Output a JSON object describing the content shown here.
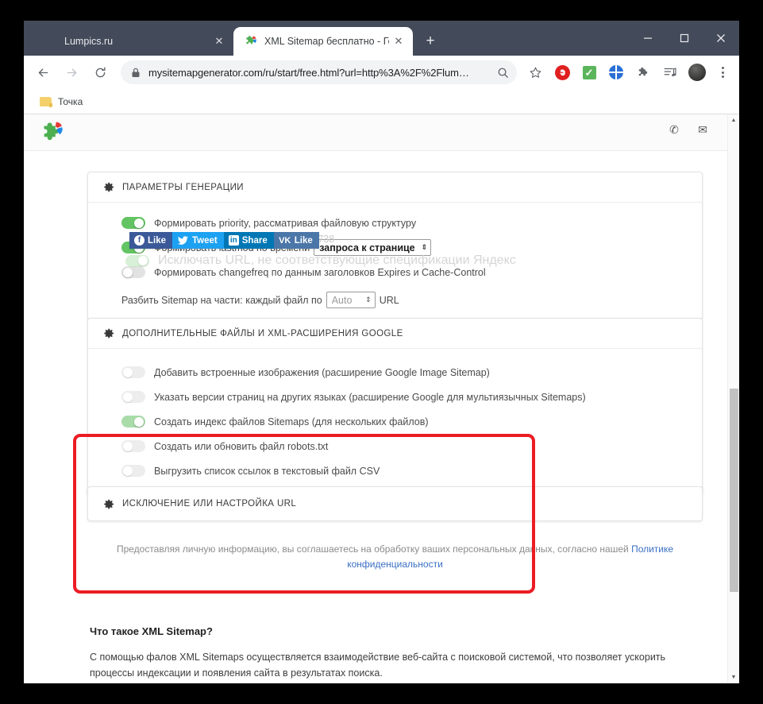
{
  "browser": {
    "tabs": [
      {
        "title": "Lumpics.ru",
        "favicon": "orange-circle-icon",
        "active": false,
        "close_label": "✕"
      },
      {
        "title": "XML Sitemap бесплатно - Генер",
        "favicon": "puzzle-icon",
        "active": true,
        "close_label": "✕"
      }
    ],
    "new_tab_label": "+",
    "window_controls": {
      "minimize": "—",
      "maximize": "□",
      "close": "✕"
    },
    "toolbar": {
      "back_label": "←",
      "forward_label": "→",
      "reload_label": "↻",
      "url": "mysitemapgenerator.com/ru/start/free.html?url=http%3A%2F%2Flum…",
      "lock_icon": "lock-icon",
      "zoom_icon": "search-icon",
      "bookmark_icon": "star-icon",
      "extensions": [
        {
          "name": "adblock-icon",
          "glyph": "✋",
          "color": "#e02020"
        },
        {
          "name": "checkmark-extension-icon",
          "glyph": "✓",
          "color": "#5bb55b"
        },
        {
          "name": "globe-extension-icon",
          "glyph": "",
          "color": "#2a6fd6"
        },
        {
          "name": "puzzle-extensions-icon",
          "glyph": "🧩",
          "color": "#5f6368"
        },
        {
          "name": "reading-list-icon",
          "glyph": "☰",
          "color": "#5f6368"
        }
      ],
      "profile_name": "avatar",
      "menu_label": "⋮"
    },
    "bookmarks": [
      {
        "label": "Точка",
        "icon": "folder-icon"
      }
    ]
  },
  "page": {
    "social_buttons": [
      {
        "label": "Like",
        "network": "facebook",
        "glyph": "f"
      },
      {
        "label": "Tweet",
        "network": "twitter",
        "glyph": "✦"
      },
      {
        "label": "Share",
        "network": "linkedin",
        "glyph": "in"
      },
      {
        "label": "Like",
        "network": "vk",
        "glyph": "VK"
      }
    ],
    "faded_top": {
      "rfc_text": "стандарту RFC 1738",
      "yandex_toggle_label": "Исключать URL, не соответствующие спецификации Яндекс"
    },
    "contact_icons": [
      {
        "name": "phone-icon",
        "glyph": "✆"
      },
      {
        "name": "envelope-icon",
        "glyph": "✉"
      }
    ],
    "panels": [
      {
        "title": "ПАРАМЕТРЫ ГЕНЕРАЦИИ",
        "options": [
          {
            "label": "Формировать priority, рассматривая файловую структуру",
            "state": "on"
          },
          {
            "label": "Формировать lastmod по времени",
            "state": "on",
            "select_value": "запроса к странице"
          },
          {
            "label": "Формировать changefreq по данным заголовков Expires и Cache-Control",
            "state": "off"
          }
        ],
        "split": {
          "prefix": "Разбить Sitemap на части: каждый файл по",
          "value": "Auto",
          "suffix": "URL"
        }
      },
      {
        "title": "ДОПОЛНИТЕЛЬНЫЕ ФАЙЛЫ И XML-РАСШИРЕНИЯ GOOGLE",
        "highlighted": true,
        "options": [
          {
            "label": "Добавить встроенные изображения (расширение Google Image Sitemap)",
            "state": "off"
          },
          {
            "label": "Указать версии страниц на других языках (расширение Google для мультиязычных Sitemaps)",
            "state": "off"
          },
          {
            "label": "Создать индекс файлов Sitemaps (для нескольких файлов)",
            "state": "on-faded"
          },
          {
            "label": "Создать или обновить файл robots.txt",
            "state": "off"
          },
          {
            "label": "Выгрузить список ссылок в текстовый файл CSV",
            "state": "off"
          }
        ]
      },
      {
        "title": "ИСКЛЮЧЕНИЕ ИЛИ НАСТРОЙКА URL",
        "options": []
      }
    ],
    "privacy": {
      "text": "Предоставляя личную информацию, вы соглашаетесь на обработку ваших персональных данных, согласно нашей ",
      "link": "Политике конфиденциальности"
    },
    "article": {
      "heading": "Что такое XML Sitemap?",
      "paragraph": "С помощью фалов XML Sitemaps осуществляется взаимодействие веб-сайта с поисковой системой, что позволяет ускорить процессы индексации и появления сайта в результатах поиска."
    },
    "scrollbar": {
      "up_arrow": "▲",
      "down_arrow": "▼"
    }
  },
  "colors": {
    "tabstrip": "#434a59",
    "highlight_red": "#ec1c24",
    "toggle_on": "#62c462",
    "toggle_on_faded": "#a9dca9",
    "toggle_off": "#e2e2e2",
    "link_blue": "#3a6fc4"
  }
}
